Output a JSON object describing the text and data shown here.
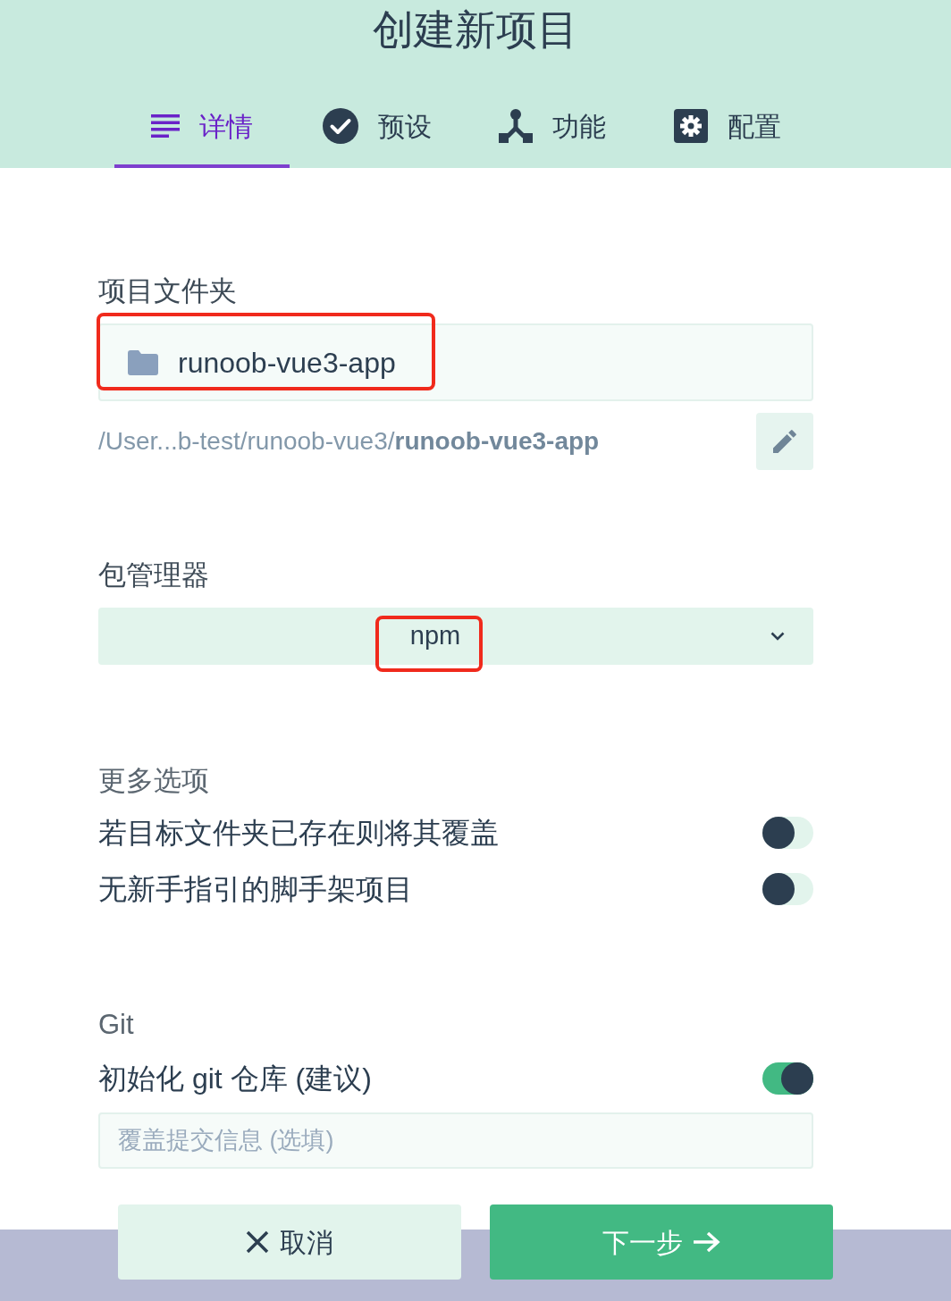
{
  "header": {
    "title": "创建新项目",
    "tabs": [
      {
        "label": "详情",
        "selected": true
      },
      {
        "label": "预设",
        "selected": false
      },
      {
        "label": "功能",
        "selected": false
      },
      {
        "label": "配置",
        "selected": false
      }
    ]
  },
  "folder": {
    "label": "项目文件夹",
    "value": "runoob-vue3-app",
    "highlighted": true,
    "path": "/User...b-test/runoob-vue3/**runoob-vue3-app**"
  },
  "package_manager": {
    "label": "包管理器",
    "value": "npm",
    "highlighted": true
  },
  "more_options": {
    "label": "更多选项",
    "options": [
      {
        "label": "若目标文件夹已存在则将其覆盖",
        "on": false
      },
      {
        "label": "无新手指引的脚手架项目",
        "on": false
      }
    ]
  },
  "git": {
    "label": "Git",
    "options": [
      {
        "label": "初始化 git 仓库 (建议)",
        "on": true
      }
    ],
    "commit_message": {
      "placeholder": "覆盖提交信息 (选填)"
    }
  },
  "buttons": [
    {
      "label": "取消",
      "kind": "secondary"
    },
    {
      "label": "下一步",
      "kind": "primary"
    }
  ]
}
